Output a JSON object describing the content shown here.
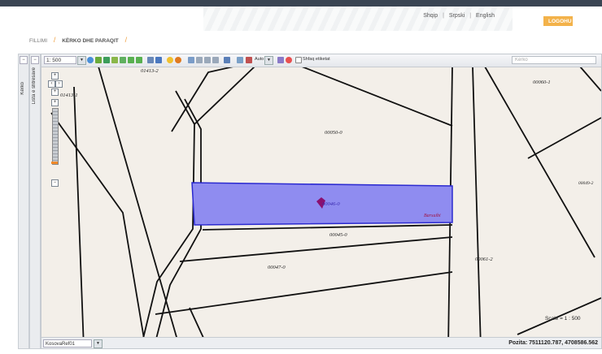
{
  "header": {
    "links": [
      "Shqip",
      "Srpski",
      "English"
    ],
    "login_label": "LOGOHU"
  },
  "breadcrumb": {
    "home": "FILLIMI",
    "current": "KËRKO DHE PARAQIT"
  },
  "side_panels": {
    "search_label": "Kërko",
    "layers_label": "Lista e shtresave"
  },
  "toolbar": {
    "scale_value": "1: 500",
    "auto_label": "Auto",
    "show_label_checkbox": "Shfaq etiketat",
    "search_placeholder": "Kërko"
  },
  "map": {
    "parcels": [
      "01413-2",
      "01413-1",
      "00060-1",
      "00050-0",
      "00049-2",
      "00046-0",
      "00045-0",
      "00047-0",
      "00061-2"
    ],
    "highlight_label": "Barsuibi"
  },
  "statusbar": {
    "layer_value": "KosovaRef01",
    "scale_text": "Scale = 1 : 500",
    "position_text": "Pozita: 7511120.787, 4708586.562"
  },
  "colors": {
    "highlight_fill": "#8f8cf0",
    "highlight_stroke": "#2b2ad0",
    "login_button": "#f3b24a",
    "zoom_thumb": "#f08a2a",
    "marker": "#8a1070"
  },
  "icons": [
    "pan-icon",
    "zoom-in-icon",
    "zoom-out-icon",
    "full-extent-icon",
    "home-icon",
    "back-icon",
    "forward-icon",
    "print-icon",
    "measure-icon",
    "info-icon",
    "layers-icon",
    "edit-icon"
  ]
}
